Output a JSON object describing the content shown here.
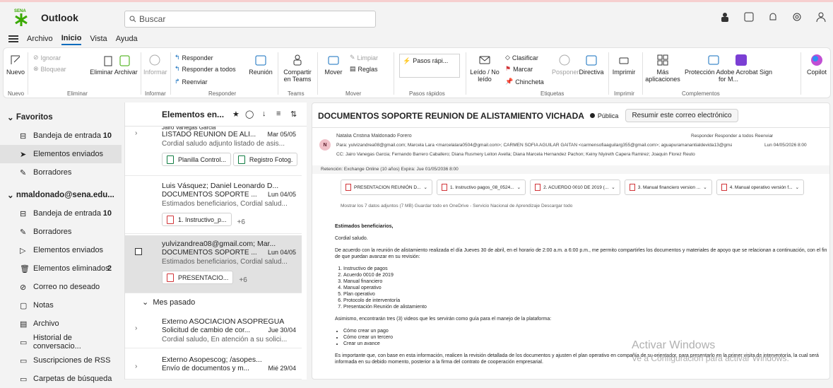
{
  "app": {
    "name": "Outlook",
    "search_placeholder": "Buscar"
  },
  "menu": {
    "items": [
      "Archivo",
      "Inicio",
      "Vista",
      "Ayuda"
    ],
    "active": "Inicio"
  },
  "ribbon": {
    "nuevo": "Nuevo",
    "ignorar": "Ignorar",
    "bloquear": "Bloquear",
    "eliminar_archivar": "Eliminar Archivar",
    "informar": "Informar",
    "responder": "Responder",
    "responder_todos": "Responder a todos",
    "reenviar": "Reenviar",
    "reunion": "Reunión",
    "compartir_teams": "Compartir en Teams",
    "mover": "Mover",
    "limpiar": "Limpiar",
    "reglas": "Reglas",
    "pasos_rapidos": "Pasos rápi...",
    "leido": "Leído / No leído",
    "clasificar": "Clasificar",
    "marcar": "Marcar",
    "chincheta": "Chincheta",
    "posponer": "Posponer",
    "directiva": "Directiva",
    "imprimir": "Imprimir",
    "mas_apps": "Más aplicaciones",
    "proteccion": "Protección Adobe Acrobat Sign for M...",
    "copilot": "Copilot",
    "groups": {
      "nuevo": "Nuevo",
      "eliminar": "Eliminar",
      "informar": "Informar",
      "responder": "Responder",
      "teams": "Teams",
      "mover": "Mover",
      "pasos": "Pasos rápidos",
      "etiquetas": "Etiquetas",
      "imprimir": "Imprimir",
      "complementos": "Complementos"
    }
  },
  "folders": {
    "favoritos": "Favoritos",
    "fav_items": [
      {
        "label": "Bandeja de entrada",
        "count": "10"
      },
      {
        "label": "Elementos enviados",
        "count": ""
      },
      {
        "label": "Borradores",
        "count": ""
      }
    ],
    "account": "nmaldonado@sena.edu...",
    "acc_items": [
      {
        "label": "Bandeja de entrada",
        "count": "10"
      },
      {
        "label": "Borradores",
        "count": ""
      },
      {
        "label": "Elementos enviados",
        "count": ""
      },
      {
        "label": "Elementos eliminados",
        "count": "2"
      },
      {
        "label": "Correo no deseado",
        "count": ""
      },
      {
        "label": "Notas",
        "count": ""
      },
      {
        "label": "Archivo",
        "count": ""
      },
      {
        "label": "Historial de conversacio...",
        "count": ""
      },
      {
        "label": "Suscripciones de RSS",
        "count": ""
      },
      {
        "label": "Carpetas de búsqueda",
        "count": ""
      }
    ]
  },
  "list": {
    "header": "Elementos en...",
    "mails": [
      {
        "from": "Jairo Vanegas Garcia",
        "subject": "LISTADO REUNION DE ALI...",
        "date": "Mar 05/05",
        "preview": "Cordial saludo adjunto listado de asis...",
        "att1": "Planilla Control...",
        "att2": "Registro Fotog."
      },
      {
        "from": "Luis Vásquez; Daniel Leonardo D...",
        "subject": "DOCUMENTOS SOPORTE ...",
        "date": "Lun 04/05",
        "preview": "Estimados beneficiarios, Cordial salud...",
        "att1": "1. Instructivo_p...",
        "more": "+6"
      },
      {
        "from": "yulvizandrea08@gmail.com; Mar...",
        "subject": "DOCUMENTOS SOPORTE ...",
        "date": "Lun 04/05",
        "preview": "Estimados beneficiarios, Cordial salud...",
        "att1": "PRESENTACIO...",
        "more": "+6"
      },
      {
        "from": "Externo  ASOCIACION ASOPREGUA",
        "subject": "Solicitud de cambio de cor...",
        "date": "Jue 30/04",
        "preview": "Cordial saludo, En atención a su solici..."
      },
      {
        "from": "Externo  Asopescog; /asopes...",
        "subject": "Envío de documentos y m...",
        "date": "Mié 29/04",
        "preview": ""
      }
    ],
    "section": "Mes pasado"
  },
  "reading": {
    "title": "DOCUMENTOS SOPORTE REUNION DE ALISTAMIENTO VICHADA",
    "public": "Pública",
    "summary": "Resumir este correo electrónico",
    "sender": "Natalia Cristina Maldonado Forero",
    "initials": "N",
    "to": "Para:  yulvizandrea08@gmail.com;  Marcela Lara <marcelalara0504@gmail.com>;  CARMEN SOFIA AGUILAR GAITAN <carmensofiaaguilarg355@gmail.com>;  aguapuramanantialdevida13@gmail.com;  y 5 más",
    "cc": "CC:  Jairo Vanegas Garcia;  Fernando Barrero Caballero;  Diana Rusmery Leiton Avella;  Diana Marcela Hernandez Pachon;  Keiny Niyireth Capera Ramirez;  Joaquin Florez Reuto",
    "datetime": "Lun 04/05/2026 8:00",
    "actions": "Responder   Responder a todos   Reenviar",
    "retention": "Retención: Exchange Online (10 años) Expira: Jue 01/05/2036 8:00",
    "attachments": [
      {
        "name": "PRESENTACION REUNIÓN D...",
        "size": "2 MB"
      },
      {
        "name": "1. Instructivo pagos_08_0524...",
        "size": "1 MB"
      },
      {
        "name": "2. ACUERDO 0010 DE 2019 (...",
        "size": "491 KB"
      },
      {
        "name": "3. Manual financiero version ...",
        "size": "497 KB"
      },
      {
        "name": "4. Manual operativo versión f...",
        "size": "444 KB"
      }
    ],
    "att_actions": "Mostrar los 7 datos adjuntos (7 MB)    Guardar todo en OneDrive - Servicio Nacional de Aprendizaje    Descargar todo",
    "greeting": "Estimados beneficiarios,",
    "saludo": "Cordial saludo.",
    "para1": "De acuerdo con la reunión de alistamiento realizada el  día Jueves 30 de abril, en el horario de 2:00 a.m. a 6:00 p.m., me permito compartirles los documentos y materiales de apoyo que se relacionan a continuación, con el fin de que puedan avanzar en su revisión:",
    "docs": [
      "Instructivo de pagos",
      "Acuerdo 0010 de 2019",
      "Manual financiero",
      "Manual operativo",
      "Plan operativo",
      "Protocolo de interventoría",
      "Presentación Reunión de alistamiento"
    ],
    "para2": "Asimismo, encontrarán tres (3) videos que les servirán como guía para el manejo de la plataforma:",
    "videos": [
      "Cómo crear un pago",
      "Cómo crear un tercero",
      "Crear un avance"
    ],
    "para3": "Es importante que, con base en esta información, realicen la revisión detallada de los documentos y ajusten el plan operativo en compañía de su orientador, para presentarlo en la primer visita de interventoría, la cual será informada en su debido momento, posterior a la firma del contrato de cooperación empresarial.",
    "watermark1": "Activar Windows",
    "watermark2": "Ve a Configuración para activar Windows."
  }
}
